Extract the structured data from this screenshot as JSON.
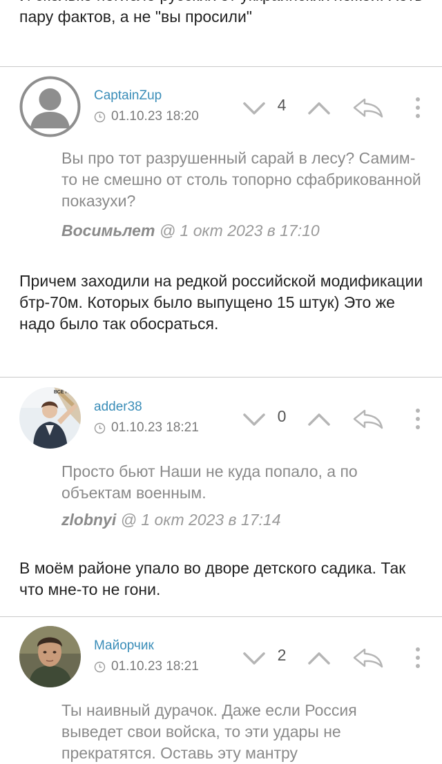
{
  "top_text": "И сколько погибло русских от уккраинских ножей. Хоть пару фактов, а не \"вы просили\"",
  "comments": [
    {
      "username": "CaptainZup",
      "date": "01.10.23 18:20",
      "score": "4",
      "quote": "Вы про тот разрушенный сарай в лесу? Самим-то не смешно от столь топорно сфабрикованной показухи?",
      "quote_author": "Восимьлет",
      "quote_meta": "@ 1 окт 2023 в 17:10",
      "body": "Причем заходили на редкой российской модификации бтр-70м. Которых было выпущено 15 штук) Это же надо было так обосраться.",
      "avatar": "default-user-icon"
    },
    {
      "username": "adder38",
      "date": "01.10.23 18:21",
      "score": "0",
      "quote": "Просто бьют Наши не куда попало, а по объектам военным.",
      "quote_author": "zlobnyi",
      "quote_meta": "@ 1 окт 2023 в 17:14",
      "body": "В моём районе упало во дворе детского садика. Так что мне-то не гони.",
      "avatar_caption": "ВСЁ НА"
    },
    {
      "username": "Майорчик",
      "date": "01.10.23 18:21",
      "score": "2",
      "quote": "Ты наивный дурачок. Даже если Россия выведет свои войска, то эти удары не прекратятся. Оставь эту мантру",
      "avatar": "man-portrait"
    }
  ],
  "colors": {
    "username": "#3a8db8",
    "meta": "#7a7a7a",
    "quote": "#8a8a8a",
    "divider": "#c9c9c9",
    "icon": "#b5b5b5"
  },
  "icons": {
    "vote_down": "chevron-down-icon",
    "vote_up": "chevron-up-icon",
    "reply": "reply-arrow-icon",
    "more": "more-vertical-icon",
    "clock": "clock-icon"
  }
}
